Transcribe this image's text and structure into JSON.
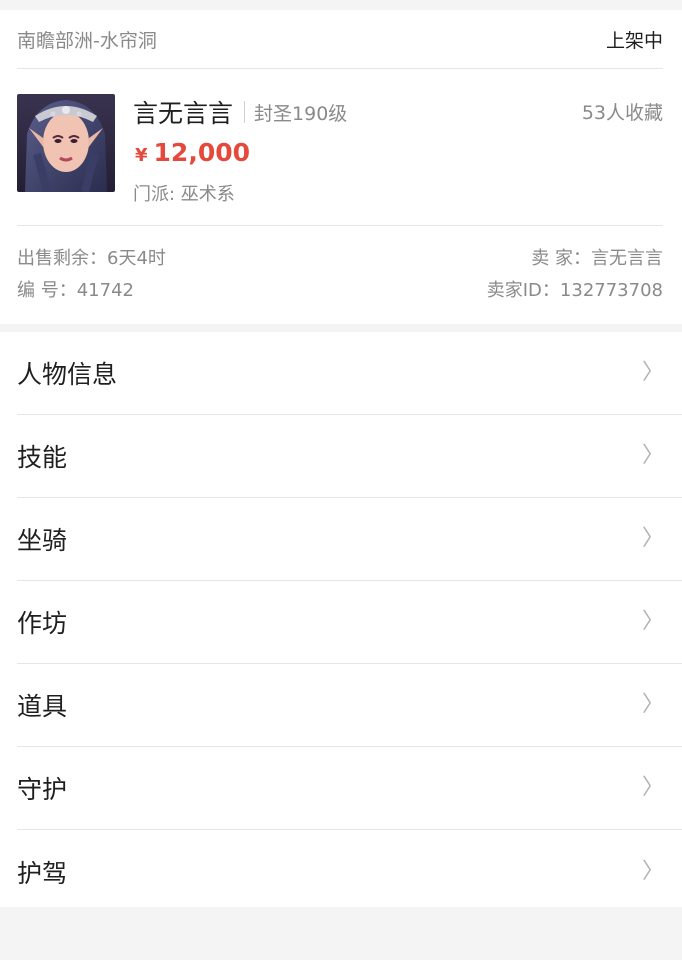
{
  "header": {
    "server": "南瞻部洲-水帘洞",
    "status": "上架中"
  },
  "character": {
    "name": "言无言言",
    "level": "封圣190级",
    "favorites": "53人收藏",
    "price_symbol": "¥",
    "price": "12,000",
    "school_label": "门派: 巫术系",
    "sale_remaining": "出售剩余：6天4时",
    "serial": "编 号：41742",
    "seller": "卖 家：言无言言",
    "seller_id": "卖家ID：132773708"
  },
  "menu": {
    "items": [
      {
        "label": "人物信息"
      },
      {
        "label": "技能"
      },
      {
        "label": "坐骑"
      },
      {
        "label": "作坊"
      },
      {
        "label": "道具"
      },
      {
        "label": "守护"
      },
      {
        "label": "护驾"
      }
    ]
  },
  "colors": {
    "price": "#e5493c",
    "muted": "#8a8a8a",
    "background": "#f4f4f4"
  }
}
